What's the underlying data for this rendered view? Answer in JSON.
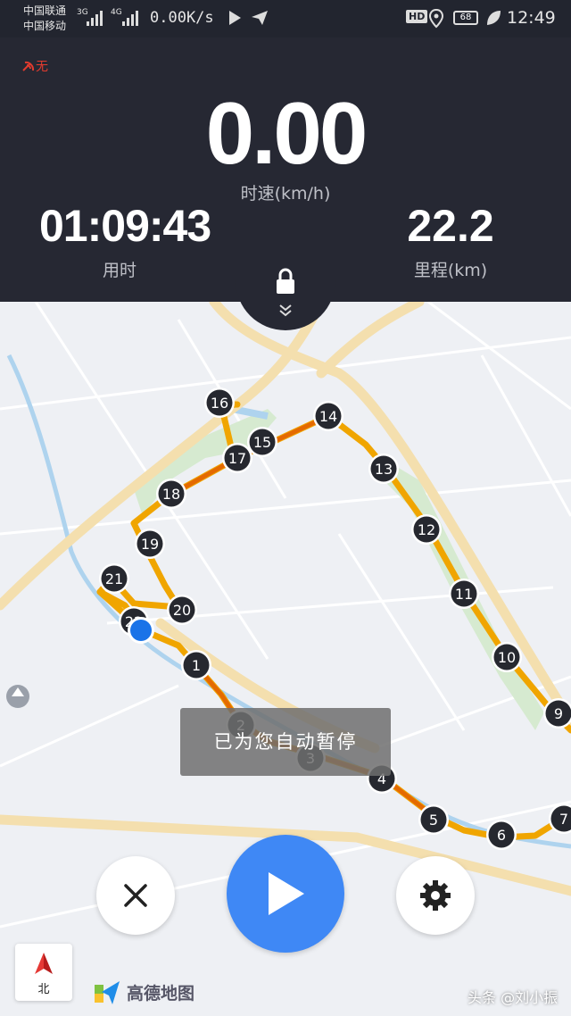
{
  "status_bar": {
    "carrier_1": "中国联通",
    "carrier_2": "中国移动",
    "net_1": "3G",
    "net_2": "4G",
    "net_speed": "0.00K/s",
    "hd_label": "HD",
    "battery": "68",
    "time": "12:49"
  },
  "tracking": {
    "gps_label": "无",
    "speed_value": "0.00",
    "speed_label": "时速(km/h)",
    "duration_value": "01:09:43",
    "duration_label": "用时",
    "distance_value": "22.2",
    "distance_label": "里程(km)"
  },
  "map": {
    "route_markers": [
      "1",
      "2",
      "3",
      "4",
      "5",
      "6",
      "7",
      "9",
      "10",
      "11",
      "12",
      "13",
      "14",
      "15",
      "16",
      "17",
      "18",
      "19",
      "20",
      "21",
      "22"
    ],
    "toast_text": "已为您自动暂停",
    "compass_label": "北",
    "provider_label": "高德地图",
    "colors": {
      "route_orange": "#f2a100",
      "route_dark": "#e46a00",
      "current_location": "#1a73e8"
    }
  },
  "watermark": "头条 @刘小振"
}
